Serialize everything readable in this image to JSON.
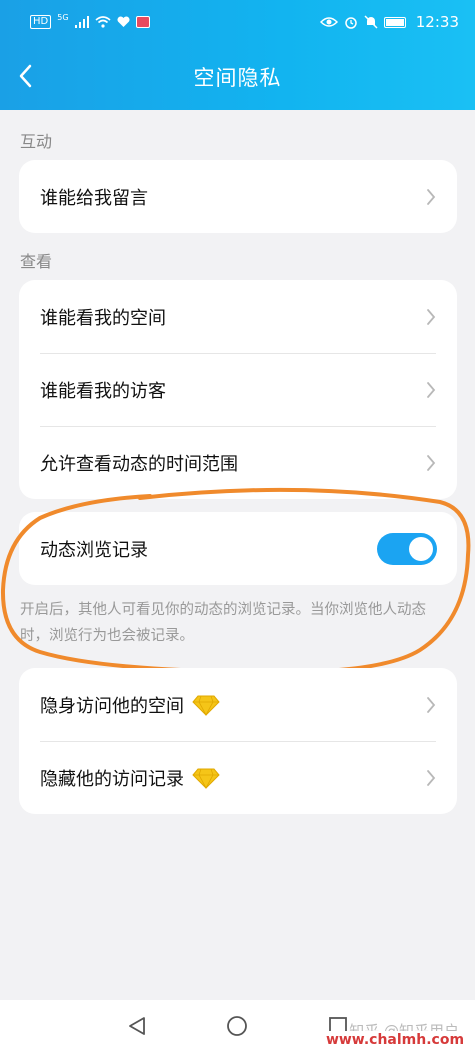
{
  "status_bar": {
    "network": "HD",
    "signal": "5G",
    "time": "12:33"
  },
  "header": {
    "title": "空间隐私"
  },
  "sections": [
    {
      "label": "互动",
      "items": [
        {
          "label": "谁能给我留言"
        }
      ]
    },
    {
      "label": "查看",
      "items": [
        {
          "label": "谁能看我的空间"
        },
        {
          "label": "谁能看我的访客"
        },
        {
          "label": "允许查看动态的时间范围"
        }
      ]
    }
  ],
  "toggle_setting": {
    "label": "动态浏览记录",
    "enabled": true,
    "description": "开启后，其他人可看见你的动态的浏览记录。当你浏览他人动态时，浏览行为也会被记录。"
  },
  "vip_items": [
    {
      "label": "隐身访问他的空间",
      "badge_icon": "yellow-diamond-icon"
    },
    {
      "label": "隐藏他的访问记录",
      "badge_icon": "yellow-diamond-icon"
    }
  ],
  "watermark": "知乎 @知乎用户",
  "site_mark": "www.chalmh.com",
  "colors": {
    "header_start": "#1aa0e6",
    "header_end": "#1ac0f4",
    "toggle_on": "#1ba4f2",
    "annotation": "#f08a2c",
    "diamond": "#f5c518",
    "site_mark": "#d63a3a"
  }
}
